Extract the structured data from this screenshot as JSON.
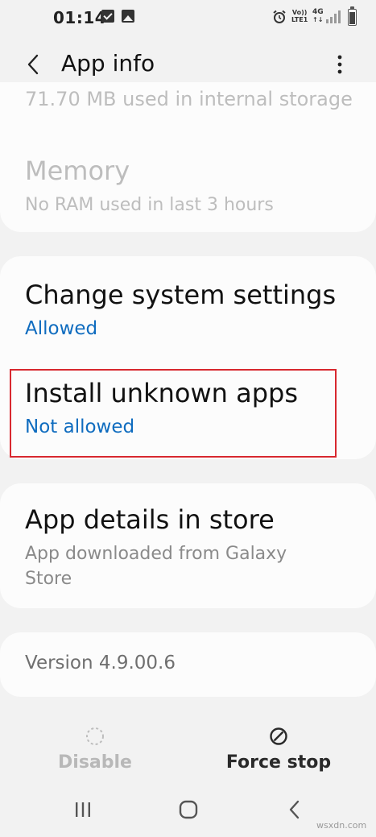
{
  "status_bar": {
    "time": "01:14",
    "icons": [
      "check-icon",
      "image-icon",
      "alarm-icon",
      "volte-icon",
      "4g-icon",
      "signal-icon",
      "battery-icon"
    ],
    "volte_label_top": "Vo))",
    "volte_label_bottom": "LTE1",
    "network": "4G"
  },
  "app_bar": {
    "title": "App info",
    "back_icon": "back-arrow-icon",
    "more_icon": "more-vert-icon"
  },
  "storage_memory": {
    "storage_text": "71.70 MB used in internal storage",
    "memory_title": "Memory",
    "memory_subtitle": "No RAM used in last 3 hours"
  },
  "permissions": [
    {
      "title": "Change system settings",
      "status": "Allowed"
    },
    {
      "title": "Install unknown apps",
      "status": "Not allowed"
    }
  ],
  "store": {
    "title": "App details in store",
    "subtitle": "App downloaded from Galaxy Store"
  },
  "version": "Version 4.9.00.6",
  "bottom_actions": {
    "disable_label": "Disable",
    "force_stop_label": "Force stop"
  },
  "nav_bar": {
    "recents_icon": "recents-icon",
    "home_icon": "home-icon",
    "back_icon": "nav-back-icon"
  },
  "watermark": "wsxdn.com",
  "colors": {
    "background": "#f2f2f2",
    "card": "#fcfcfc",
    "accent_blue": "#0f6cbf",
    "highlight_red": "#d8282f",
    "disabled_text": "#bdbdbd"
  }
}
